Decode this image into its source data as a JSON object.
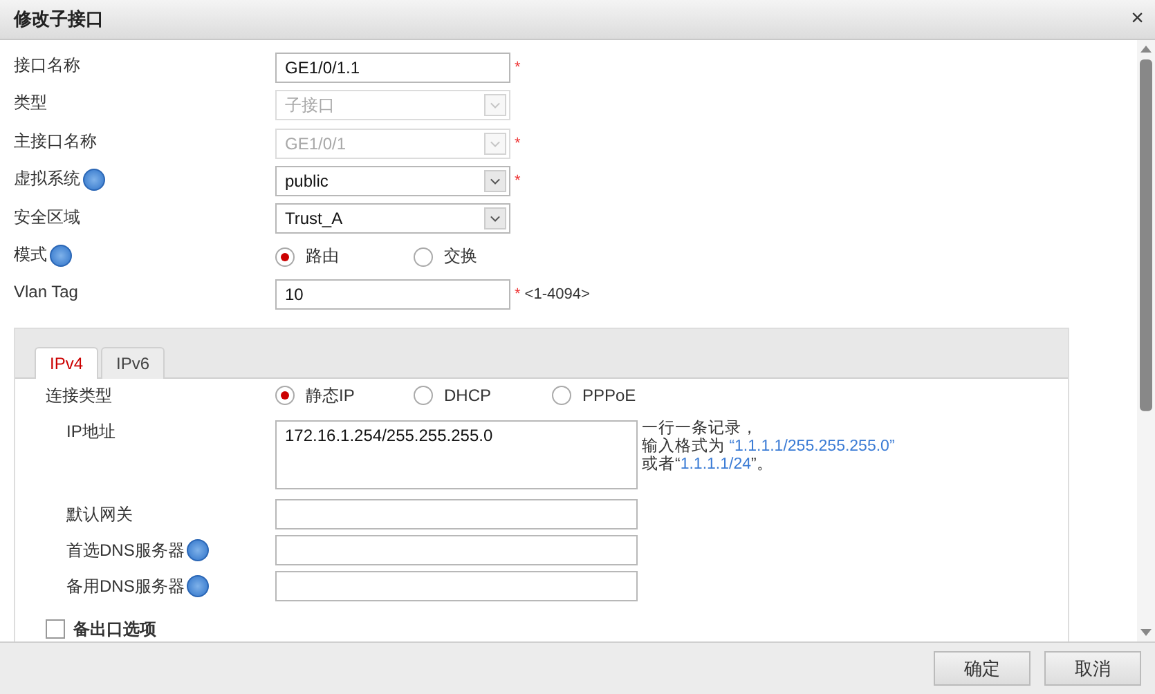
{
  "window": {
    "title": "修改子接口",
    "close": "×"
  },
  "fields": [
    {
      "kind": "text",
      "label": "接口名称",
      "value": "GE1/0/1.1",
      "required": "*"
    },
    {
      "kind": "select",
      "label": "类型",
      "value": "子接口",
      "disabled": true
    },
    {
      "kind": "select",
      "label": "主接口名称",
      "value": "GE1/0/1",
      "required": "*",
      "disabled": true
    },
    {
      "kind": "select",
      "label": "虚拟系统",
      "help": true,
      "value": "public",
      "required": "*",
      "disabled": false
    },
    {
      "kind": "select",
      "label": "安全区域",
      "value": "Trust_A",
      "disabled": false
    },
    {
      "kind": "radio",
      "label": "模式",
      "help": true,
      "options": [
        {
          "label": "路由",
          "selected": true
        },
        {
          "label": "交换",
          "selected": false
        }
      ]
    },
    {
      "kind": "text",
      "label": "Vlan Tag",
      "value": "10",
      "required": "*",
      "range": "<1-4094>"
    }
  ],
  "tabs": [
    {
      "label": "IPv4",
      "selected": true
    },
    {
      "label": "IPv6",
      "selected": false
    }
  ],
  "connection": {
    "label": "连接类型",
    "options": [
      {
        "label": "静态IP",
        "selected": true
      },
      {
        "label": "DHCP",
        "selected": false
      },
      {
        "label": "PPPoE",
        "selected": false
      }
    ]
  },
  "ip": {
    "label": "IP地址",
    "value": "172.16.1.254/255.255.255.0",
    "hint": [
      [
        {
          "text": "一行一条记录，",
          "highlight": false
        }
      ],
      [
        {
          "text": "输入格式为 ",
          "highlight": false
        },
        {
          "text": "“1.1.1.1/255.255.255.0”",
          "highlight": true
        }
      ],
      [
        {
          "text": "或者“",
          "highlight": false
        },
        {
          "text": "1.1.1.1/24",
          "highlight": true
        },
        {
          "text": "”。",
          "highlight": false
        }
      ]
    ]
  },
  "ip_fields": [
    {
      "label": "默认网关"
    },
    {
      "label": "首选DNS服务器",
      "help": true
    },
    {
      "label": "备用DNS服务器",
      "help": true
    }
  ],
  "backup": {
    "label": "备出口选项",
    "checked": false
  },
  "buttons": [
    "确定",
    "取消"
  ]
}
